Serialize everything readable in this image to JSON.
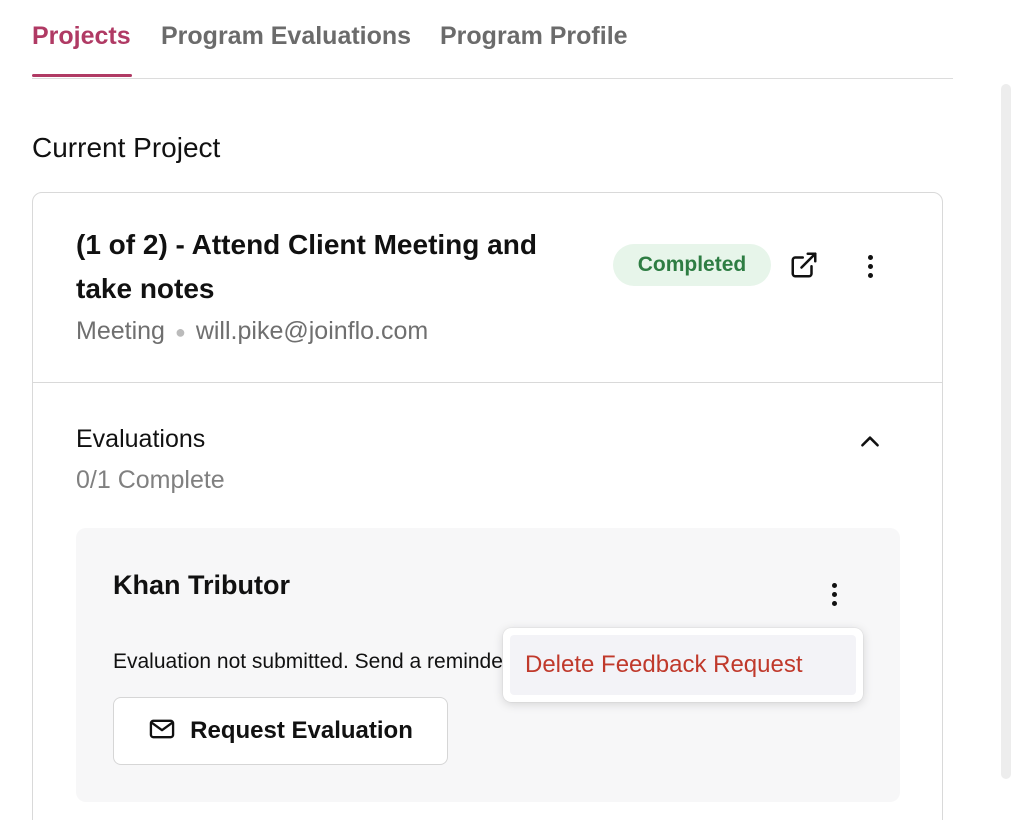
{
  "tabs": [
    {
      "label": "Projects",
      "active": true
    },
    {
      "label": "Program Evaluations",
      "active": false
    },
    {
      "label": "Program Profile",
      "active": false
    }
  ],
  "section_title": "Current Project",
  "project": {
    "title": "(1 of 2) - Attend Client Meeting and take notes",
    "type": "Meeting",
    "email": "will.pike@joinflo.com",
    "status": "Completed",
    "open_icon": "external-link-icon",
    "menu_icon": "more-vertical-icon"
  },
  "evaluations": {
    "title": "Evaluations",
    "progress": "0/1 Complete",
    "collapse_icon": "chevron-up-icon",
    "items": [
      {
        "name": "Khan Tributor",
        "status_text": "Evaluation not submitted. Send a reminder",
        "action_label": "Request Evaluation",
        "action_icon": "mail-icon",
        "menu_icon": "more-vertical-icon"
      }
    ]
  },
  "dropdown": {
    "items": [
      {
        "label": "Delete Feedback Request"
      }
    ]
  },
  "colors": {
    "accent": "#b03a64",
    "badge_bg": "#e7f5ea",
    "badge_text": "#2e7d43",
    "danger": "#c0392b"
  }
}
